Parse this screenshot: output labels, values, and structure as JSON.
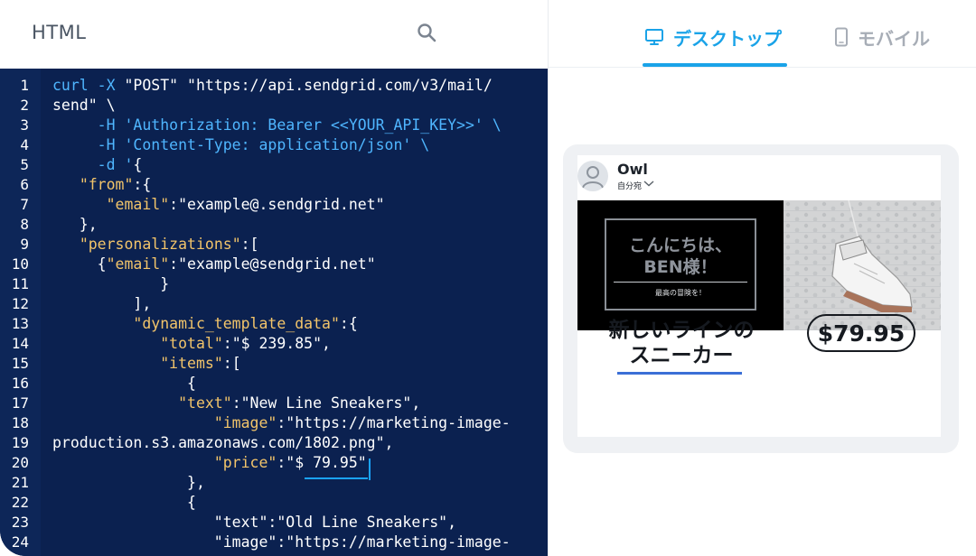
{
  "editor": {
    "title": "HTML",
    "line_numbers": [
      "1",
      "2",
      "3",
      "4",
      "5",
      "6",
      "7",
      "8",
      "9",
      "10",
      "11",
      "12",
      "13",
      "14",
      "15",
      "16",
      "17",
      "18",
      "19",
      "20",
      "21",
      "22",
      "23",
      "24"
    ],
    "lines": [
      [
        {
          "t": "curl -X",
          "c": "cmd"
        },
        {
          "t": " \"POST\" \"https://api.sendgrid.com/v3/mail/",
          "c": "str"
        }
      ],
      [
        {
          "t": "send\" \\",
          "c": "str"
        }
      ],
      [
        {
          "t": "     -H 'Authorization: Bearer <<YOUR_API_KEY>>' \\",
          "c": "cmd"
        }
      ],
      [
        {
          "t": "     -H 'Content-Type: application/json' \\",
          "c": "cmd"
        }
      ],
      [
        {
          "t": "     -d '",
          "c": "cmd"
        },
        {
          "t": "{",
          "c": "p"
        }
      ],
      [
        {
          "t": "   ",
          "c": "p"
        },
        {
          "t": "\"from\"",
          "c": "key"
        },
        {
          "t": ":{",
          "c": "p"
        }
      ],
      [
        {
          "t": "      ",
          "c": "p"
        },
        {
          "t": "\"email\"",
          "c": "key"
        },
        {
          "t": ":\"example@.sendgrid.net\"",
          "c": "str"
        }
      ],
      [
        {
          "t": "   },",
          "c": "p"
        }
      ],
      [
        {
          "t": "   ",
          "c": "p"
        },
        {
          "t": "\"personalizations\"",
          "c": "key"
        },
        {
          "t": ":[",
          "c": "p"
        }
      ],
      [
        {
          "t": "     {",
          "c": "p"
        },
        {
          "t": "\"email\"",
          "c": "key"
        },
        {
          "t": ":\"example@sendgrid.net\"",
          "c": "str"
        }
      ],
      [
        {
          "t": "            }",
          "c": "p"
        }
      ],
      [
        {
          "t": "         ],",
          "c": "p"
        }
      ],
      [
        {
          "t": "         ",
          "c": "p"
        },
        {
          "t": "\"dynamic_template_data\"",
          "c": "key"
        },
        {
          "t": ":{",
          "c": "p"
        }
      ],
      [
        {
          "t": "            ",
          "c": "p"
        },
        {
          "t": "\"total\"",
          "c": "key"
        },
        {
          "t": ":\"$ 239.85\",",
          "c": "str"
        }
      ],
      [
        {
          "t": "            ",
          "c": "p"
        },
        {
          "t": "\"items\"",
          "c": "key"
        },
        {
          "t": ":[",
          "c": "p"
        }
      ],
      [
        {
          "t": "               {",
          "c": "p"
        }
      ],
      [
        {
          "t": "              ",
          "c": "p"
        },
        {
          "t": "\"text\"",
          "c": "key"
        },
        {
          "t": ":\"New Line Sneakers\",",
          "c": "str"
        }
      ],
      [
        {
          "t": "                  ",
          "c": "p"
        },
        {
          "t": "\"image\"",
          "c": "key"
        },
        {
          "t": ":\"https://marketing-image-",
          "c": "str"
        }
      ],
      [
        {
          "t": "production.s3.amazonaws.com/1802.png\",",
          "c": "str"
        }
      ],
      [
        {
          "t": "                  ",
          "c": "p"
        },
        {
          "t": "\"price\"",
          "c": "key"
        },
        {
          "t": ":\"$ 79.95\"",
          "c": "str"
        }
      ],
      [
        {
          "t": "               },",
          "c": "p"
        }
      ],
      [
        {
          "t": "               {",
          "c": "p"
        }
      ],
      [
        {
          "t": "                  \"text\":\"Old Line Sneakers\",",
          "c": "str"
        }
      ],
      [
        {
          "t": "                  \"image\":\"https://marketing-image-",
          "c": "str"
        }
      ]
    ]
  },
  "preview": {
    "tabs": [
      {
        "label": "デスクトップ",
        "icon": "desktop-icon",
        "active": true
      },
      {
        "label": "モバイル",
        "icon": "mobile-icon",
        "active": false
      }
    ],
    "sender": {
      "name": "Owl",
      "to": "自分宛"
    },
    "hero": {
      "title_line1": "こんにちは、",
      "title_line2": "BEN様！",
      "subtitle": "最高の冒険を！"
    },
    "product": {
      "name_line1": "新しいラインの",
      "name_line2": "スニーカー",
      "price": "$79.95"
    }
  },
  "colors": {
    "accent": "#1aa3e8",
    "code_bg": "#0b2150",
    "code_command": "#4fb6ff",
    "code_key": "#f2c46a",
    "product_underline": "#3b6fd6"
  }
}
